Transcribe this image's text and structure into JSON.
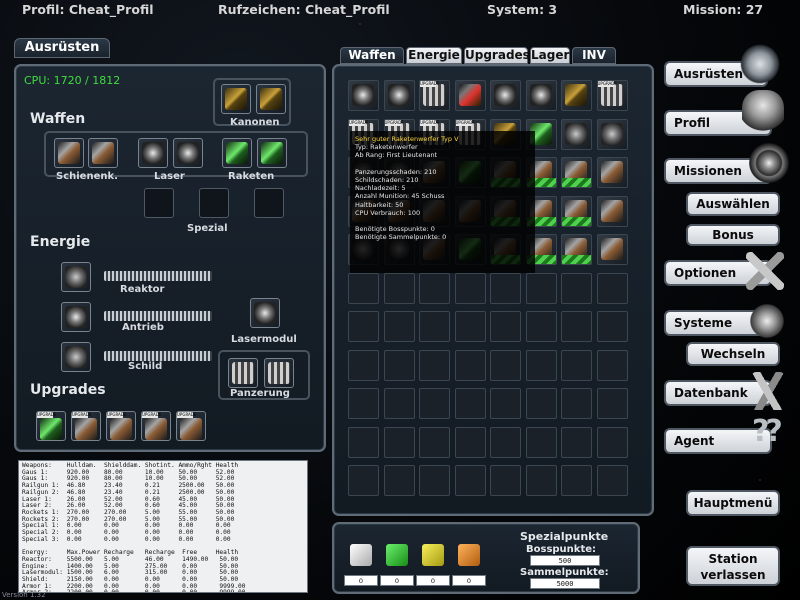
{
  "topbar": {
    "profil": "Profil:  Cheat_Profil",
    "rufzeichen": "Rufzeichen:  Cheat_Profil",
    "system": "System: 3",
    "mission": "Mission: 27"
  },
  "left": {
    "tab": "Ausrüsten",
    "cpu": "CPU: 1720 / 1812",
    "waffen": "Waffen",
    "kanonen": "Kanonen",
    "schienenk": "Schienenk.",
    "laser": "Laser",
    "raketen": "Raketen",
    "spezial": "Spezial",
    "energie": "Energie",
    "reaktor": "Reaktor",
    "antrieb": "Antrieb",
    "schild": "Schild",
    "lasermodul": "Lasermodul",
    "panzerung": "Panzerung",
    "upgrades": "Upgrades",
    "upgrade_tag": "UPGRADE"
  },
  "tabs": [
    "Waffen",
    "Energie",
    "Upgrades",
    "Lager",
    "INV"
  ],
  "tooltip": {
    "title": "Sehr guter Raketenwerfer Typ V",
    "lines": [
      "Typ: Raketenwerfer",
      "Ab Rang: First Lieutenant",
      "",
      "Panzerungsschaden: 210",
      "Schildschaden: 210",
      "Nachladezeit: 5",
      "Anzahl Munition: 45 Schuss",
      "Haltbarkeit: 50",
      "CPU Verbrauch: 100",
      "",
      "Benötigte Bosspunkte: 0",
      "Benötigte Sammelpunkte: 0"
    ]
  },
  "stats_text": "Weapons:    Hulldam.  Shielddam. Shotint. Ammo/Rght Health\nGaus 1:     920.00    80.00      10.00    50.00     52.00\nGaus 1:     920.00    80.00      10.00    50.00     52.00\nRailgun 1:  46.80     23.40      0.21     2500.00   50.00\nRailgun 2:  46.80     23.40      0.21     2500.00   50.00\nLaser 1:    26.00     52.00      0.60     45.00     50.00\nLaser 2:    26.00     52.00      0.60     45.00     50.00\nRockets 1:  270.00    270.00     5.00     55.00     50.00\nRockets 2:  270.00    270.00     5.00     55.00     50.00\nSpecial 1:  0.00      0.00       0.00     0.00      0.00\nSpecial 2:  0.00      0.00       0.00     0.00      0.00\nSpecial 3:  0.00      0.00       0.00     0.00      0.00\n\nEnergy:     Max.Power Recharge   Recharge  Free     Health\nReactor:    5500.00   5.00       46.00     1490.00   50.00\nEngine:     1400.00   5.00       275.00    0.00      50.00\nLasermodul: 1500.00   6.00       315.00    0.00      50.00\nShield:     2150.00   0.00       0.00      0.00      50.00\nArmor 1:    2200.00   0.00       0.00      0.00      9999.00\nArmor 2:    2200.00   0.00       0.00      0.00      9999.00",
  "special": {
    "title": "Spezialpunkte",
    "boss_label": "Bosspunkte:",
    "boss": "500",
    "sammel_label": "Sammelpunkte:",
    "sammel": "5000",
    "counts": [
      "0",
      "0",
      "0",
      "0"
    ]
  },
  "menu": [
    "Ausrüsten",
    "Profil",
    "Missionen",
    "Auswählen",
    "Bonus",
    "Optionen",
    "Systeme",
    "Wechseln",
    "Datenbank",
    "Agent",
    "Hauptmenü",
    "Station",
    "verlassen"
  ],
  "version": "Version 1.32"
}
